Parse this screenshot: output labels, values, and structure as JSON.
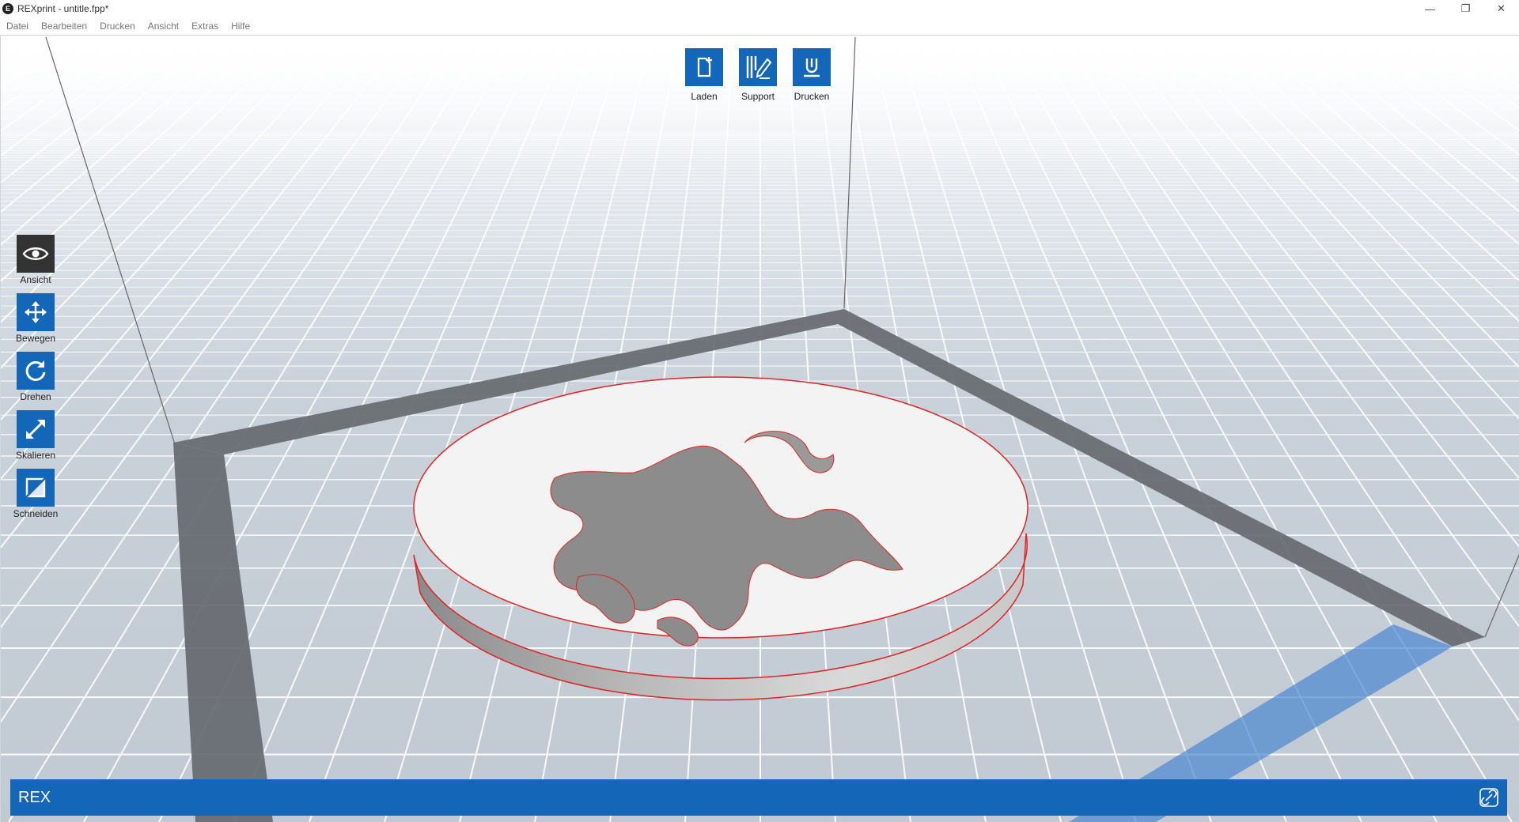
{
  "window": {
    "title": "REXprint - untitle.fpp*",
    "icon_letter": "E",
    "controls": {
      "minimize": "—",
      "restore": "❐",
      "close": "✕"
    }
  },
  "menu": [
    "Datei",
    "Bearbeiten",
    "Drucken",
    "Ansicht",
    "Extras",
    "Hilfe"
  ],
  "top_toolbar": [
    {
      "label": "Laden",
      "icon": "new-file-icon"
    },
    {
      "label": "Support",
      "icon": "support-icon"
    },
    {
      "label": "Drucken",
      "icon": "print-icon"
    }
  ],
  "left_toolbar": [
    {
      "label": "Ansicht",
      "icon": "eye-icon",
      "active": true
    },
    {
      "label": "Bewegen",
      "icon": "move-icon",
      "active": false
    },
    {
      "label": "Drehen",
      "icon": "rotate-icon",
      "active": false
    },
    {
      "label": "Skalieren",
      "icon": "scale-icon",
      "active": false
    },
    {
      "label": "Schneiden",
      "icon": "cut-icon",
      "active": false
    }
  ],
  "status": {
    "text": "REX",
    "icon": "link-icon"
  },
  "colors": {
    "accent": "#1466b8",
    "active_tool": "#333333",
    "model_outline": "#e02424",
    "model_top": "#f3f3f3",
    "bed_frame": "#6b6e72",
    "floor": "#c4ccd5"
  }
}
